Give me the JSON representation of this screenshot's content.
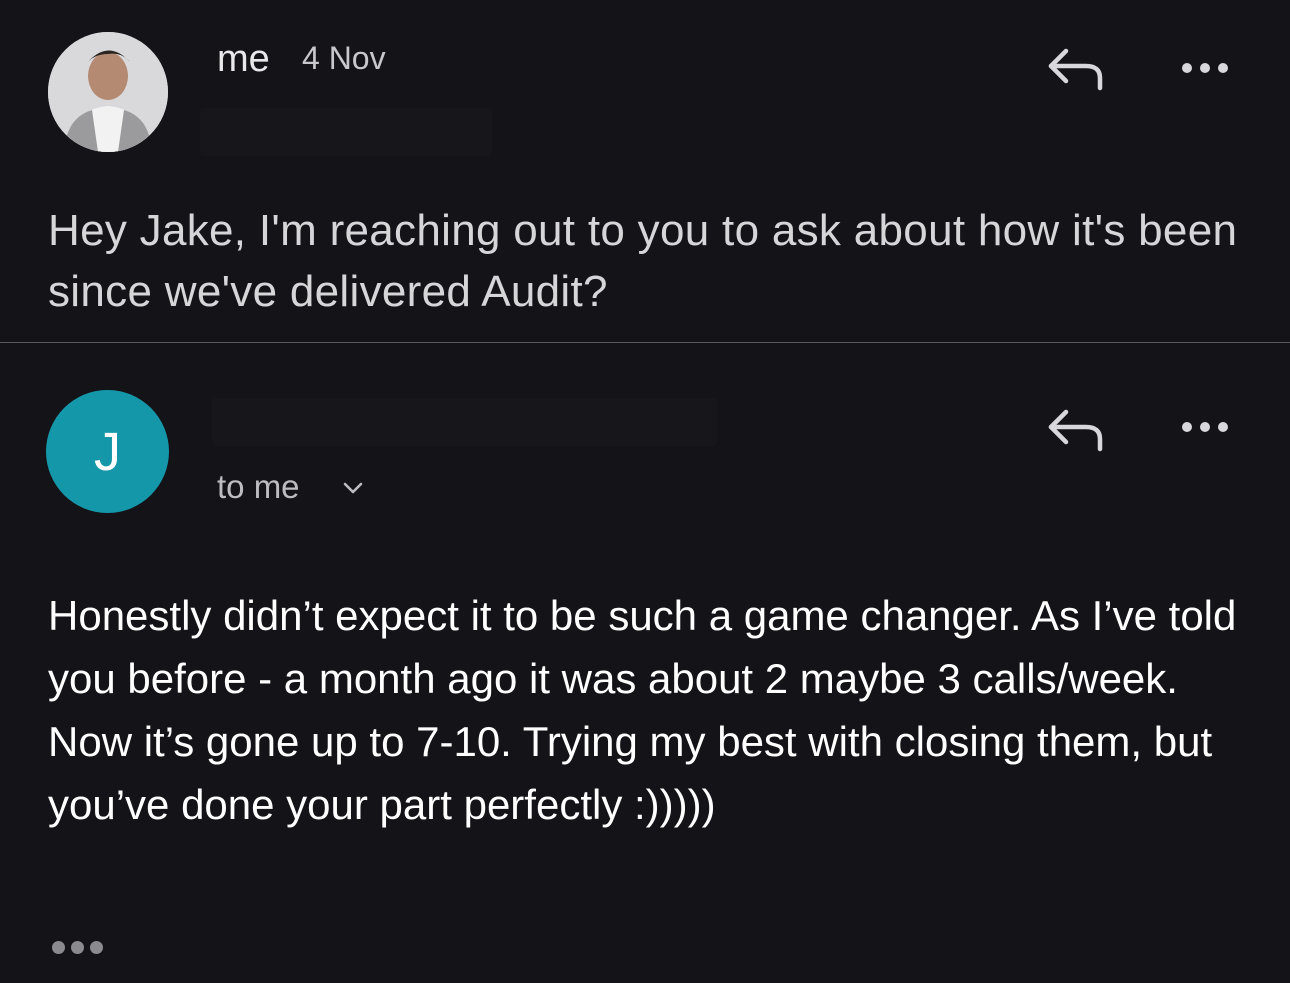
{
  "message1": {
    "sender": "me",
    "date": "4 Nov",
    "body": "Hey Jake, I'm reaching out to you to ask about how it's been since we've delivered Audit?",
    "reply_icon": "reply-icon",
    "more_icon": "more-horizontal-icon"
  },
  "message2": {
    "avatar_letter": "J",
    "avatar_color": "#1597aa",
    "recipient": "to me",
    "expand_icon": "chevron-down-icon",
    "body": "Honestly didn’t expect it to be such a game changer. As I’ve told you before - a month ago it was about 2 maybe 3 calls/week. Now it’s gone up to 7-10. Trying my best with closing them, but you’ve done your part perfectly :)))))",
    "reply_icon": "reply-icon",
    "more_icon": "more-horizontal-icon",
    "trimmed_icon": "trimmed-content-icon"
  }
}
